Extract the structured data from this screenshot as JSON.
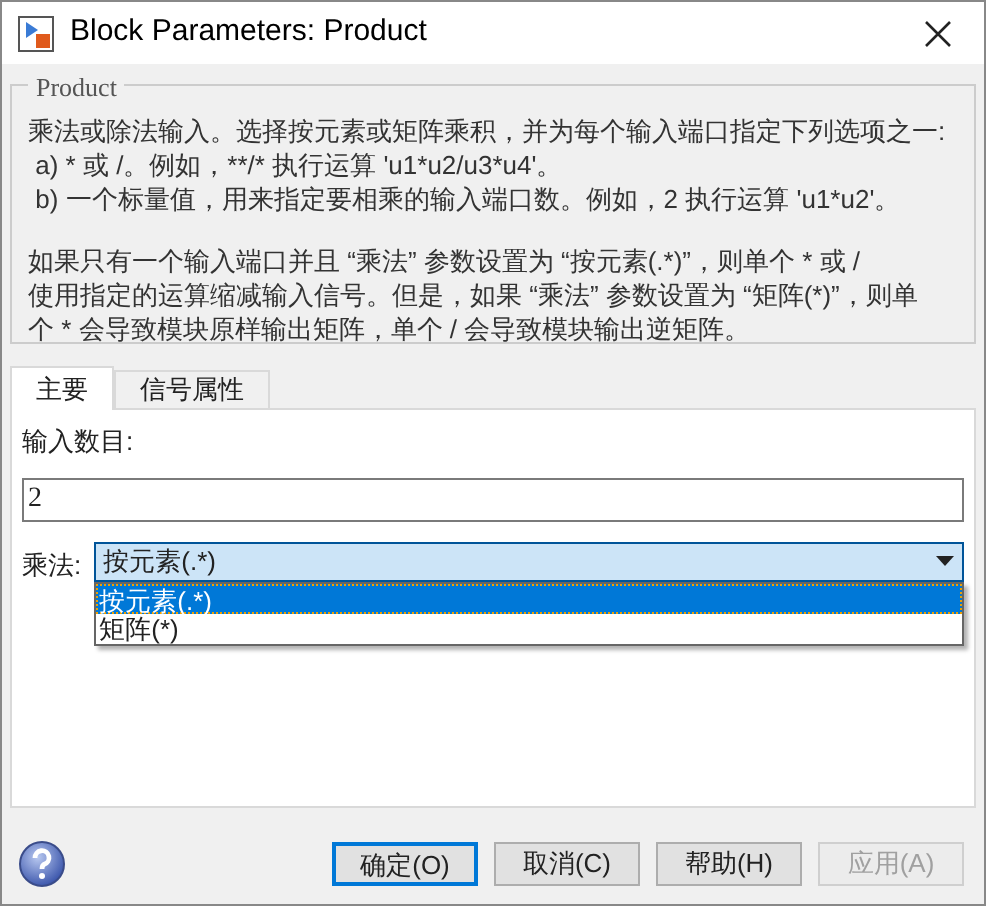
{
  "window": {
    "title": "Block Parameters: Product"
  },
  "description": {
    "title": "Product",
    "paragraphs": [
      [
        "乘法或除法输入。选择按元素或矩阵乘积，并为每个输入端口指定下列选项之一:",
        " a) * 或 /。例如，**/* 执行运算 'u1*u2/u3*u4'。",
        " b) 一个标量值，用来指定要相乘的输入端口数。例如，2 执行运算 'u1*u2'。"
      ],
      [
        "如果只有一个输入端口并且 “乘法” 参数设置为 “按元素(.*)”，则单个 * 或 /",
        "使用指定的运算缩减输入信号。但是，如果 “乘法” 参数设置为 “矩阵(*)”，则单",
        "个 * 会导致模块原样输出矩阵，单个 / 会导致模块输出逆矩阵。"
      ]
    ]
  },
  "tabs": [
    {
      "label": "主要",
      "selected": true
    },
    {
      "label": "信号属性",
      "selected": false
    }
  ],
  "inputs": {
    "label": "输入数目:",
    "value": "2"
  },
  "multiplication": {
    "label": "乘法:",
    "value": "按元素(.*)",
    "expanded": true,
    "options": [
      {
        "label": "按元素(.*)",
        "selected": true
      },
      {
        "label": "矩阵(*)",
        "selected": false
      }
    ]
  },
  "buttons": [
    {
      "label": "确定(O)",
      "focused": true,
      "disabled": false
    },
    {
      "label": "取消(C)",
      "focused": false,
      "disabled": false
    },
    {
      "label": "帮助(H)",
      "focused": false,
      "disabled": false
    },
    {
      "label": "应用(A)",
      "focused": false,
      "disabled": true
    }
  ]
}
